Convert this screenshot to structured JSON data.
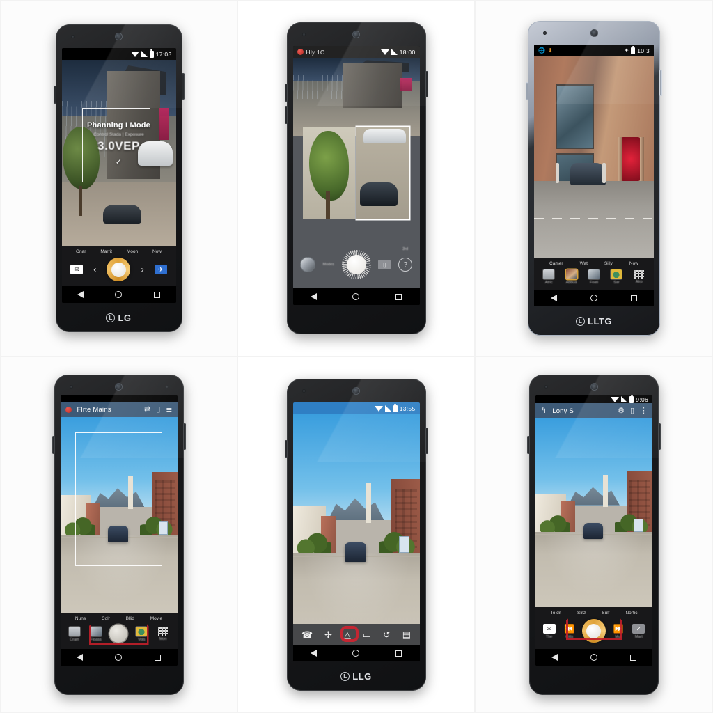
{
  "image": {
    "title": "LG Android camera app screenshot grid",
    "layout": "2 rows x 3 columns of phone mockups",
    "background_color": "#ffffff"
  },
  "panels": [
    {
      "id": "panel-1",
      "position": "top-left",
      "device_brand": "LG",
      "device_color": "black",
      "statusbar": {
        "title": "",
        "clock": "17:03",
        "icons": [
          "wifi-icon",
          "signal-icon",
          "battery-icon"
        ]
      },
      "overlay": {
        "title": "Phanning I Mode",
        "subtitle": "Control Stada | Exposure",
        "value": "3.0VEP",
        "confirm_icon": "checkmark-icon"
      },
      "mode_strip": [
        "Onar",
        "Marrit",
        "Moon",
        "Now"
      ],
      "controls": [
        {
          "name": "mail-button",
          "glyph": "✉"
        },
        {
          "name": "previous-button",
          "glyph": "‹"
        },
        {
          "name": "shutter-button",
          "glyph": ""
        },
        {
          "name": "next-button",
          "glyph": "›"
        },
        {
          "name": "send-button",
          "glyph": "✈"
        }
      ],
      "navbar": [
        "back-button",
        "home-button",
        "recents-button"
      ]
    },
    {
      "id": "panel-2",
      "position": "top-center",
      "device_brand": "",
      "device_color": "black",
      "statusbar": {
        "title": "Hly 1C",
        "clock": "18:00",
        "icons": [
          "app-dot-icon",
          "wifi-icon",
          "signal-icon"
        ]
      },
      "preview": {
        "left_label": "tree-thumbnail",
        "right_label": "car-thumbnail-selected"
      },
      "controls": [
        {
          "name": "lens-selector",
          "label": ""
        },
        {
          "name": "mode-label",
          "label": "Modes"
        },
        {
          "name": "shutter-dial",
          "label": ""
        },
        {
          "name": "storage-chip",
          "label": "storage"
        },
        {
          "name": "help-button",
          "label": "?"
        }
      ],
      "corner_label": "3rd",
      "navbar": [
        "back-button",
        "home-button",
        "recents-button"
      ]
    },
    {
      "id": "panel-3",
      "position": "top-right",
      "device_brand": "LLTG",
      "device_color": "silver",
      "statusbar": {
        "left_icons": [
          "globe-icon",
          "download-icon"
        ],
        "right_icons": [
          "flash-icon",
          "battery-icon"
        ],
        "clock": "10:3"
      },
      "mode_strip": [
        "Camer",
        "Wat",
        "Silly",
        "Now"
      ],
      "app_tiles": [
        {
          "label": "Atric",
          "icon": "battery-tile-icon"
        },
        {
          "label": "Abbua",
          "icon": "photo-tile-icon"
        },
        {
          "label": "Foati",
          "icon": "people-tile-icon"
        },
        {
          "label": "Sar",
          "icon": "leaf-tile-icon"
        },
        {
          "label": "Alrp",
          "icon": "apps-grid-icon"
        }
      ],
      "navbar": [
        "back-button",
        "home-button",
        "recents-button"
      ]
    },
    {
      "id": "panel-4",
      "position": "bottom-left",
      "device_brand": "",
      "device_color": "black",
      "actionbar": {
        "title": "Flrte Mains",
        "icons": [
          "shuffle-icon",
          "card-icon",
          "sort-icon"
        ],
        "app_dot": "app-dot-icon"
      },
      "focus_frame": true,
      "mode_strip": [
        "Nuns",
        "Colr",
        "Bllid",
        "Movie"
      ],
      "controls": [
        {
          "label": "Cram",
          "icon": "battery-tile-icon"
        },
        {
          "label": "Floass",
          "icon": "photo-tile-icon"
        },
        {
          "label": "",
          "icon": "shutter-button"
        },
        {
          "label": "Vols",
          "icon": "leaf-tile-icon"
        },
        {
          "label": "Mon",
          "icon": "apps-grid-icon"
        }
      ],
      "annotation": {
        "type": "camera-outline",
        "color": "#c0202a"
      },
      "navbar": [
        "back-button",
        "home-button",
        "recents-button"
      ]
    },
    {
      "id": "panel-5",
      "position": "bottom-center",
      "device_brand": "LLG",
      "device_color": "black",
      "statusbar": {
        "title": "",
        "clock": "13:55",
        "icons": [
          "wifi-icon",
          "signal-icon",
          "battery-icon"
        ]
      },
      "toolbar": [
        {
          "name": "call-icon",
          "glyph": "⌕"
        },
        {
          "name": "crop-icon",
          "glyph": "✠"
        },
        {
          "name": "car-icon",
          "glyph": "△",
          "highlighted": true
        },
        {
          "name": "screen-icon",
          "glyph": "▭"
        },
        {
          "name": "rotate-icon",
          "glyph": "↺"
        },
        {
          "name": "panel-icon",
          "glyph": "▤"
        }
      ],
      "annotation": {
        "type": "ring",
        "color": "#cf2430",
        "target": "car-icon"
      },
      "navbar": [
        "back-button",
        "home-button",
        "recents-button"
      ]
    },
    {
      "id": "panel-6",
      "position": "bottom-right",
      "device_brand": "",
      "device_color": "black",
      "statusbar": {
        "title": "",
        "clock": "9:06",
        "icons": [
          "wifi-icon",
          "signal-icon",
          "battery-icon"
        ]
      },
      "actionbar": {
        "title": "Lony S",
        "back_icon": "back-arrow-icon",
        "icons": [
          "settings-icon",
          "card-icon",
          "overflow-icon"
        ]
      },
      "mode_strip": [
        "To dit",
        "Slitz",
        "Sulf",
        "Nortic"
      ],
      "controls": [
        {
          "label": "The",
          "name": "mail-button",
          "glyph": "✉"
        },
        {
          "label": "Citts",
          "name": "prev-track-button",
          "glyph": "⏮"
        },
        {
          "label": "",
          "name": "shutter-button",
          "glyph": ""
        },
        {
          "label": "Mur",
          "name": "next-track-button",
          "glyph": "⏭"
        },
        {
          "label": "Mart",
          "name": "confirm-button",
          "glyph": "✓"
        }
      ],
      "annotation": {
        "type": "camera-outline",
        "color": "#c0202a"
      },
      "navbar": [
        "back-button",
        "home-button",
        "recents-button"
      ]
    }
  ],
  "colors": {
    "accent_orange": "#e0a33a",
    "annotation_red": "#c0202a",
    "actionbar_blue": "#3d5a77",
    "send_blue": "#2f6fd0",
    "page_bg": "#ffffff"
  }
}
